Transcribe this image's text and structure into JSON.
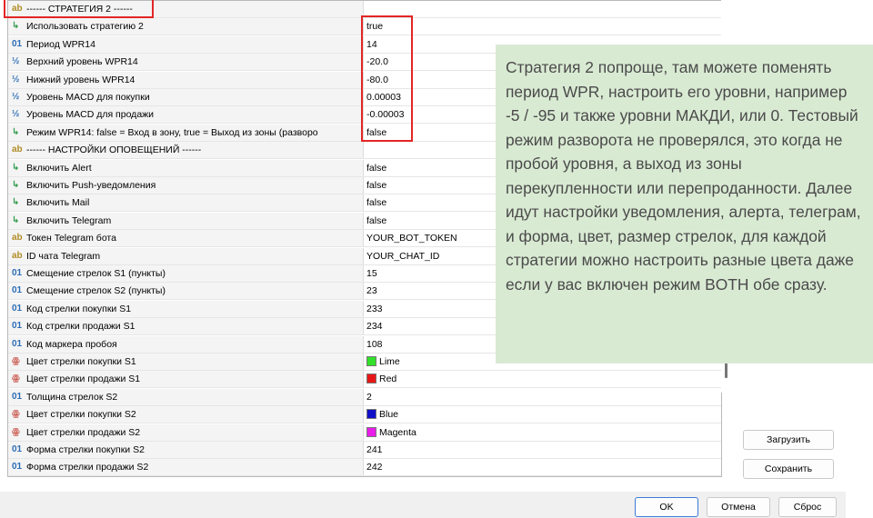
{
  "grid": {
    "rows": [
      {
        "icon": "ab",
        "name": "------ СТРАТЕГИЯ 2 ------",
        "value": ""
      },
      {
        "icon": "↳",
        "name": "Использовать стратегию 2",
        "value": "true"
      },
      {
        "icon": "01",
        "name": "Период WPR14",
        "value": "14"
      },
      {
        "icon": "½",
        "name": "Верхний уровень WPR14",
        "value": "-20.0"
      },
      {
        "icon": "½",
        "name": "Нижний уровень WPR14",
        "value": "-80.0"
      },
      {
        "icon": "½",
        "name": "Уровень MACD для покупки",
        "value": "0.00003"
      },
      {
        "icon": "½",
        "name": "Уровень MACD для продажи",
        "value": "-0.00003"
      },
      {
        "icon": "↳",
        "name": "Режим WPR14: false = Вход в зону, true = Выход из зоны (разворо",
        "value": "false"
      },
      {
        "icon": "ab",
        "name": "------ НАСТРОЙКИ ОПОВЕЩЕНИЙ ------",
        "value": ""
      },
      {
        "icon": "↳",
        "name": "Включить Alert",
        "value": "false"
      },
      {
        "icon": "↳",
        "name": "Включить Push-уведомления",
        "value": "false"
      },
      {
        "icon": "↳",
        "name": "Включить Mail",
        "value": "false"
      },
      {
        "icon": "↳",
        "name": "Включить Telegram",
        "value": "false"
      },
      {
        "icon": "ab",
        "name": "Токен Telegram бота",
        "value": "YOUR_BOT_TOKEN"
      },
      {
        "icon": "ab",
        "name": "ID чата Telegram",
        "value": "YOUR_CHAT_ID"
      },
      {
        "icon": "01",
        "name": "Смещение стрелок S1 (пункты)",
        "value": "15"
      },
      {
        "icon": "01",
        "name": "Смещение стрелок S2 (пункты)",
        "value": "23"
      },
      {
        "icon": "01",
        "name": "Код стрелки покупки S1",
        "value": "233"
      },
      {
        "icon": "01",
        "name": "Код стрелки продажи S1",
        "value": "234"
      },
      {
        "icon": "01",
        "name": "Код маркера пробоя",
        "value": "108"
      },
      {
        "icon": "ꙮ",
        "name": "Цвет стрелки покупки S1",
        "value": "Lime",
        "swatch": "#33e02a"
      },
      {
        "icon": "ꙮ",
        "name": "Цвет стрелки продажи S1",
        "value": "Red",
        "swatch": "#e81717"
      },
      {
        "icon": "01",
        "name": "Толщина стрелок S2",
        "value": "2"
      },
      {
        "icon": "ꙮ",
        "name": "Цвет стрелки покупки S2",
        "value": "Blue",
        "swatch": "#1010c8"
      },
      {
        "icon": "ꙮ",
        "name": "Цвет стрелки продажи S2",
        "value": "Magenta",
        "swatch": "#e81ee8"
      },
      {
        "icon": "01",
        "name": "Форма стрелки покупки S2",
        "value": "241"
      },
      {
        "icon": "01",
        "name": "Форма стрелки продажи S2",
        "value": "242"
      }
    ]
  },
  "note": {
    "text": "Стратегия 2 попроще, там можете поменять период WPR, настроить его уровни, например -5 / -95 и также уровни МАКДИ, или 0. Тестовый режим разворота не проверялся, это когда не пробой уровня, а выход из зоны перекупленности или перепроданности. Далее идут настройки уведомления, алерта, телеграм, и форма, цвет, размер стрелок, для каждой стратегии можно настроить разные цвета даже если у вас включен режим BOTH обе сразу."
  },
  "buttons": {
    "load": "Загрузить",
    "save": "Сохранить",
    "ok": "OK",
    "cancel": "Отмена",
    "reset": "Сброс"
  },
  "colors": {
    "annotation_bg": "#d9ead3",
    "highlight": "#e32626"
  }
}
